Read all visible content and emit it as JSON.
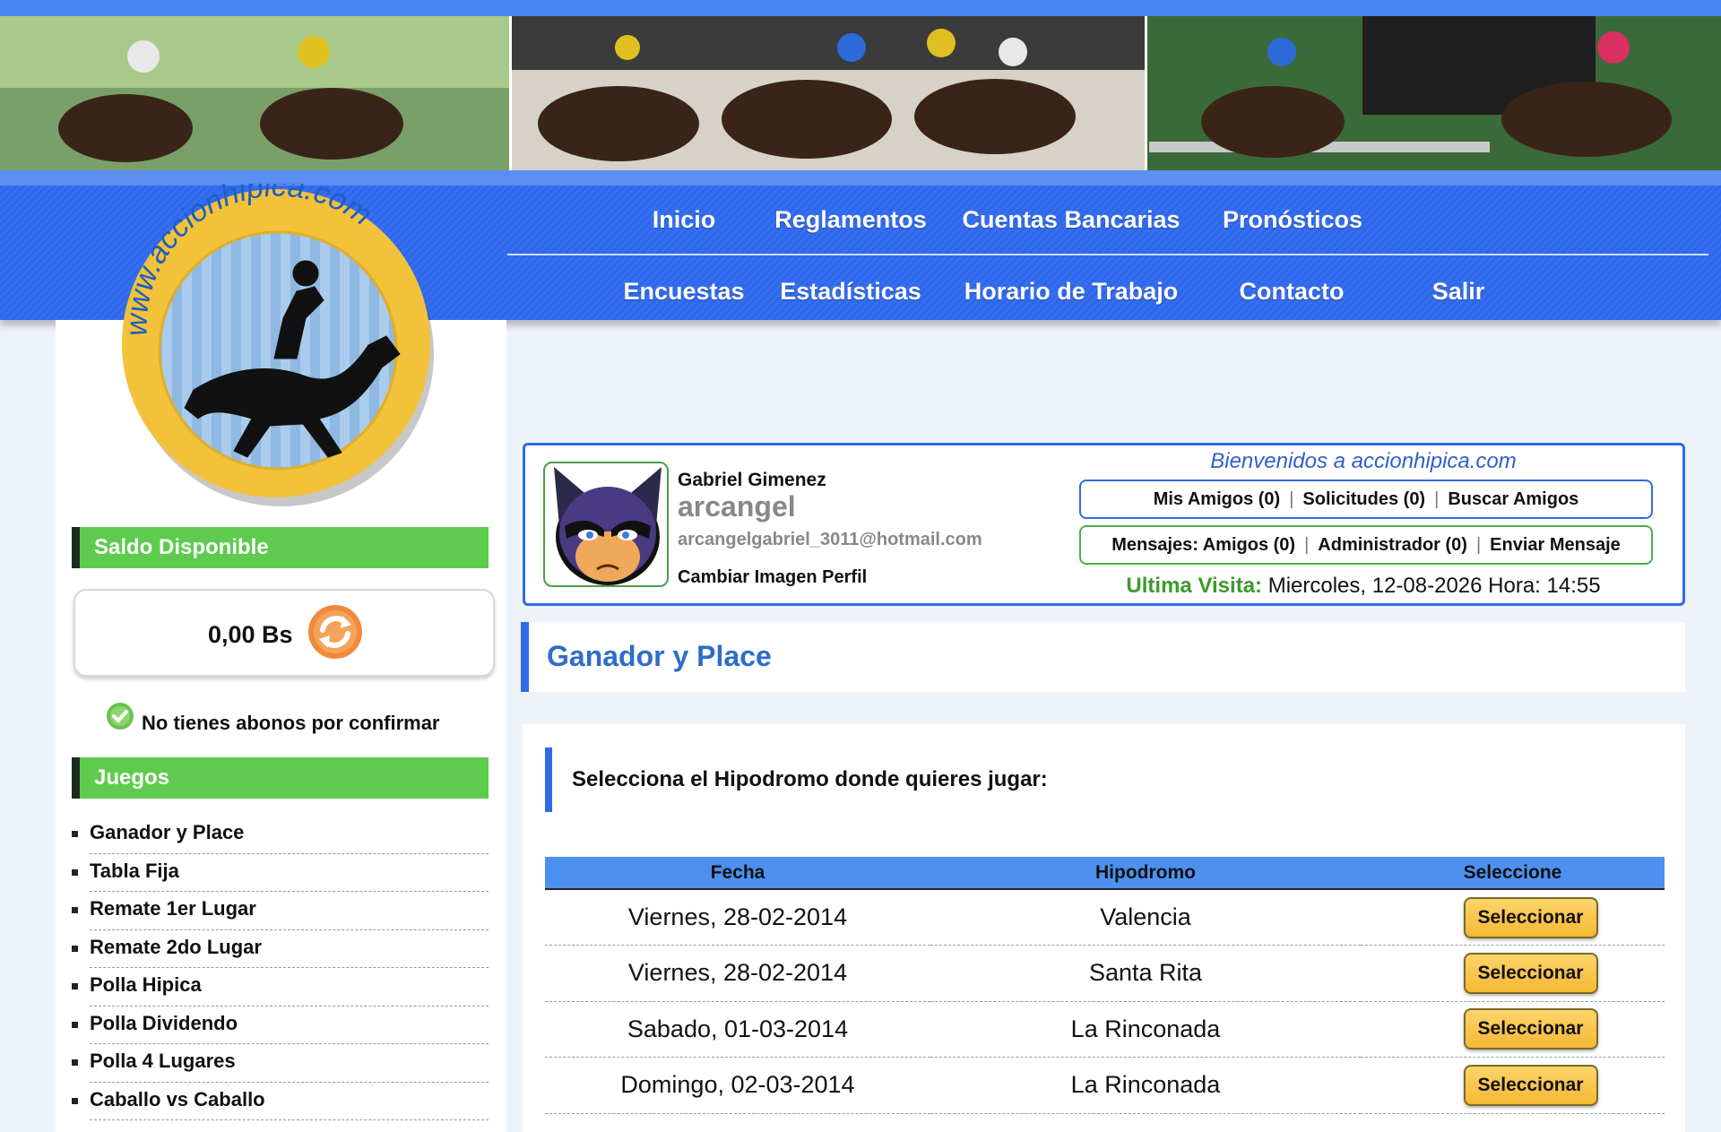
{
  "logo": {
    "text": "www.accionhipica.com"
  },
  "nav": {
    "row1": [
      "Inicio",
      "Reglamentos",
      "Cuentas Bancarias",
      "Pronósticos"
    ],
    "row2": [
      "Encuestas",
      "Estadísticas",
      "Horario de Trabajo",
      "Contacto",
      "Salir"
    ]
  },
  "sidebar": {
    "balance_header": "Saldo Disponible",
    "balance": "0,00 Bs",
    "abonos_status": "No tienes abonos por confirmar",
    "games_header": "Juegos",
    "games": [
      "Ganador y Place",
      "Tabla Fija",
      "Remate 1er Lugar",
      "Remate 2do Lugar",
      "Polla Hipica",
      "Polla Dividendo",
      "Polla 4 Lugares",
      "Caballo vs Caballo"
    ]
  },
  "profile": {
    "name": "Gabriel Gimenez",
    "username": "arcangel",
    "email": "arcangelgabriel_3011@hotmail.com",
    "change_image": "Cambiar Imagen Perfil",
    "welcome": "Bienvenidos a accionhipica.com",
    "friends_links": [
      "Mis Amigos (0)",
      "Solicitudes (0)",
      "Buscar Amigos"
    ],
    "message_links": [
      "Mensajes: Amigos (0)",
      "Administrador (0)",
      "Enviar Mensaje"
    ],
    "last_visit_label": "Ultima Visita:",
    "last_visit_value": "Miercoles, 12-08-2026 Hora: 14:55"
  },
  "main": {
    "title": "Ganador y Place",
    "prompt": "Selecciona el Hipodromo donde quieres jugar:",
    "table": {
      "headers": [
        "Fecha",
        "Hipodromo",
        "Seleccione"
      ],
      "rows": [
        {
          "fecha": "Viernes, 28-02-2014",
          "hipodromo": "Valencia",
          "button": "Seleccionar"
        },
        {
          "fecha": "Viernes, 28-02-2014",
          "hipodromo": "Santa Rita",
          "button": "Seleccionar"
        },
        {
          "fecha": "Sabado, 01-03-2014",
          "hipodromo": "La Rinconada",
          "button": "Seleccionar"
        },
        {
          "fecha": "Domingo, 02-03-2014",
          "hipodromo": "La Rinconada",
          "button": "Seleccionar"
        }
      ]
    }
  },
  "colors": {
    "nav_blue": "#2f67ec",
    "sidebar_green": "#5ecb4f",
    "title_blue": "#2f6dc8",
    "table_header": "#4d90ef",
    "button_yellow": "#f5b833"
  }
}
